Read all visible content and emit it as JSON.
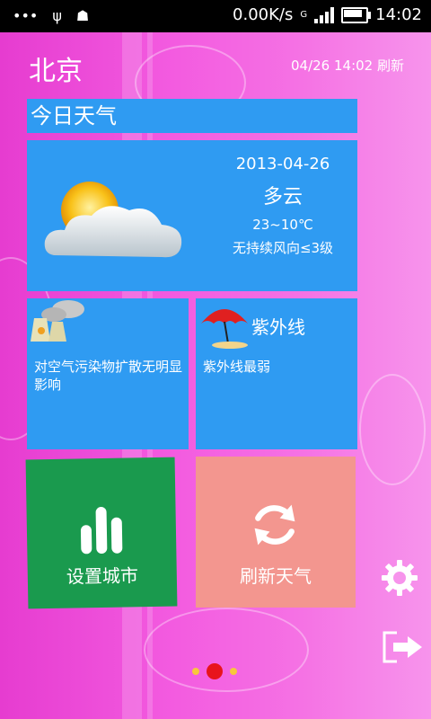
{
  "status_bar": {
    "speed": "0.00K/s",
    "time": "14:02",
    "network": "G"
  },
  "header": {
    "city": "北京",
    "updated": "04/26 14:02 刷新"
  },
  "today": {
    "title": "今日天气",
    "date": "2013-04-26",
    "condition": "多云",
    "temperature": "23~10℃",
    "wind": "无持续风向≤3级",
    "icon": "cloudy-sun-icon"
  },
  "pollution": {
    "text": "对空气污染物扩散无明显影响",
    "icon": "factory-icon"
  },
  "uv": {
    "title": "紫外线",
    "text": "紫外线最弱",
    "icon": "umbrella-icon"
  },
  "actions": {
    "set_city": "设置城市",
    "refresh": "刷新天气"
  },
  "colors": {
    "tile_blue": "#2f9bf2",
    "tile_green": "#1a9a4e",
    "tile_salmon": "#f3968f",
    "background_pink": "#f05ad8"
  },
  "pager": {
    "count": 3,
    "active": 2
  }
}
